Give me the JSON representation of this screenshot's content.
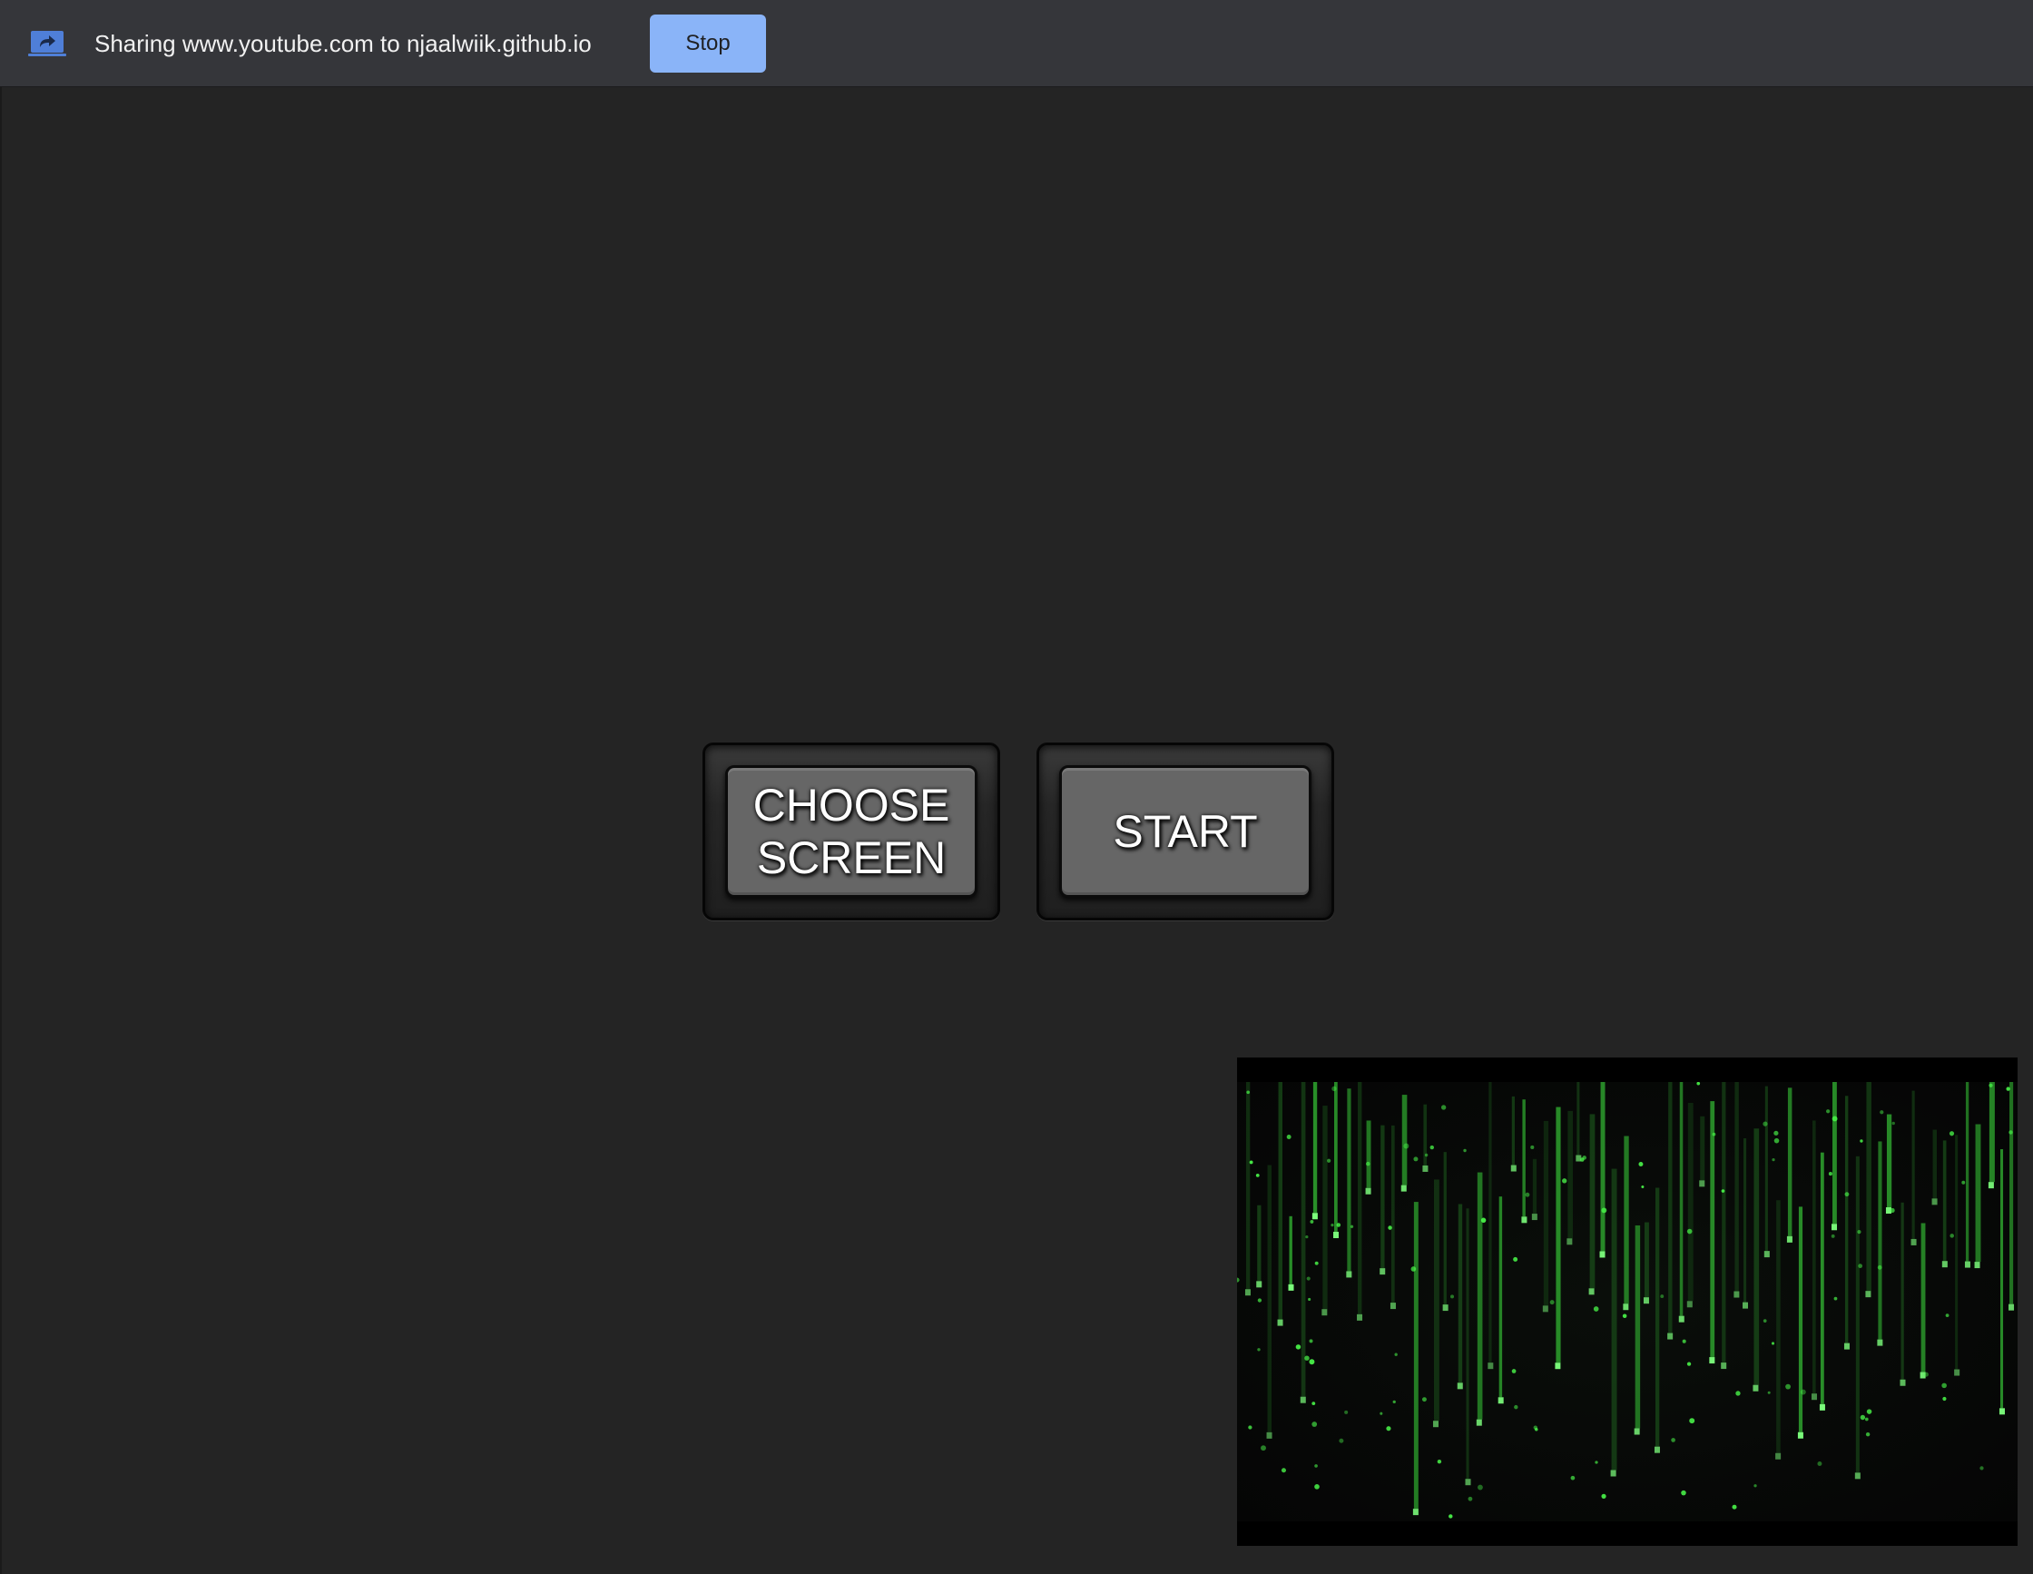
{
  "share_bar": {
    "icon": "screen-share-icon",
    "message": "Sharing www.youtube.com to njaalwiik.github.io",
    "stop_label": "Stop"
  },
  "controls": {
    "choose_screen_label": "CHOOSE SCREEN",
    "start_label": "START"
  },
  "preview": {
    "description_icon": "matrix-code-rain-video"
  },
  "colors": {
    "share_bar_bg": "#35363a",
    "stop_button": "#8ab4f8",
    "page_bg": "#242424",
    "button_face": "#666666",
    "matrix_green": "#3ddc3d"
  }
}
